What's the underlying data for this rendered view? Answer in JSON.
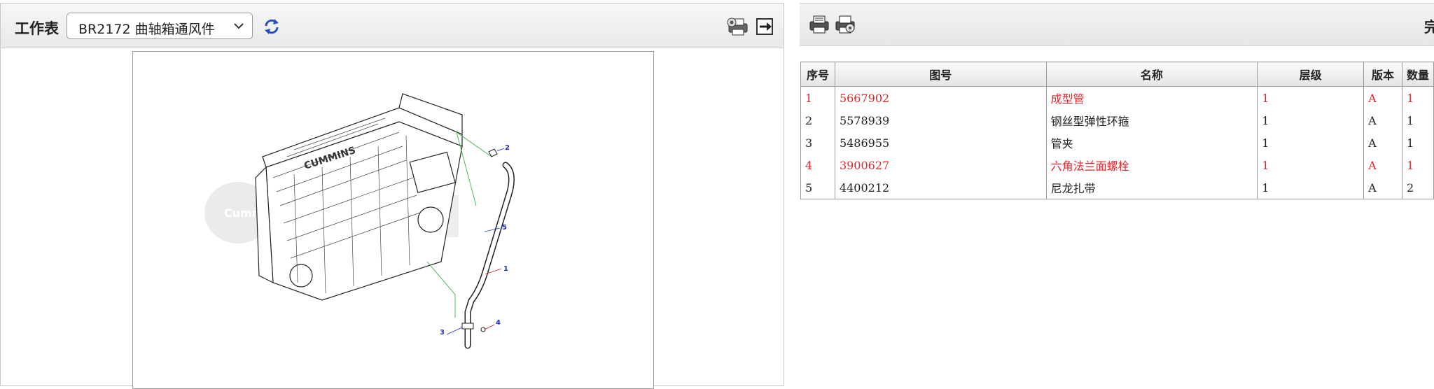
{
  "worksheet": {
    "label": "工作表",
    "selected": "BR2172 曲轴箱通风件"
  },
  "right_toolbar": {
    "clipped_text": "完"
  },
  "diagram": {
    "callouts": [
      {
        "id": "1",
        "color": "#d0252b"
      },
      {
        "id": "2",
        "color": "#2233bb"
      },
      {
        "id": "3",
        "color": "#2233bb"
      },
      {
        "id": "4",
        "color": "#2233bb"
      },
      {
        "id": "5",
        "color": "#2233bb"
      }
    ],
    "watermark_latin": "Cummins"
  },
  "parts_table": {
    "headers": [
      "序号",
      "图号",
      "名称",
      "层级",
      "版本",
      "数量"
    ],
    "rows": [
      {
        "seq": "1",
        "part_no": "5667902",
        "name": "成型管",
        "level": "1",
        "version": "A",
        "qty": "1",
        "highlight": true
      },
      {
        "seq": "2",
        "part_no": "5578939",
        "name": "钢丝型弹性环箍",
        "level": "1",
        "version": "A",
        "qty": "1",
        "highlight": false
      },
      {
        "seq": "3",
        "part_no": "5486955",
        "name": "管夹",
        "level": "1",
        "version": "A",
        "qty": "1",
        "highlight": false
      },
      {
        "seq": "4",
        "part_no": "3900627",
        "name": "六角法兰面螺栓",
        "level": "1",
        "version": "A",
        "qty": "1",
        "highlight": true
      },
      {
        "seq": "5",
        "part_no": "4400212",
        "name": "尼龙扎带",
        "level": "1",
        "version": "A",
        "qty": "2",
        "highlight": false
      }
    ]
  },
  "colors": {
    "highlight_red": "#e0262c",
    "callout_blue": "#2233bb"
  }
}
